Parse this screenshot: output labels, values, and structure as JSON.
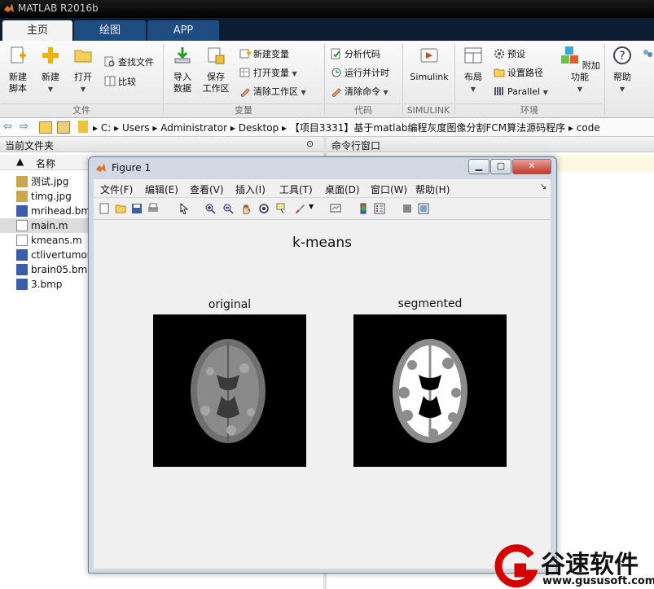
{
  "app": {
    "title": "MATLAB R2016b"
  },
  "tabs": [
    {
      "label": "主页"
    },
    {
      "label": "绘图"
    },
    {
      "label": "APP"
    }
  ],
  "ribbon": {
    "new_script": "新建\n脚本",
    "new": "新建",
    "open": "打开",
    "find_files": "查找文件",
    "compare": "比较",
    "import_data": "导入\n数据",
    "save_workspace": "保存\n工作区",
    "new_variable": "新建变量",
    "open_variable": "打开变量",
    "clear_workspace": "清除工作区",
    "analyze_code": "分析代码",
    "run_and_time": "运行并计时",
    "clear_commands": "清除命令",
    "simulink": "Simulink",
    "layout": "布局",
    "preferences": "预设",
    "set_path": "设置路径",
    "parallel": "Parallel",
    "addons": "附加功能",
    "help": "帮助",
    "groups": {
      "file": "文件",
      "variable": "变量",
      "code": "代码",
      "simulink": "SIMULINK",
      "environment": "环境"
    }
  },
  "address": {
    "segments": [
      "C:",
      "Users",
      "Administrator",
      "Desktop",
      "【项目3331】基于matlab编程灰度图像分割FCM算法源码程序",
      "code"
    ]
  },
  "left_panel": {
    "title": "当前文件夹",
    "col_name": "名称",
    "sort_arrow": "▲",
    "files": [
      {
        "name": "测试.jpg"
      },
      {
        "name": "timg.jpg"
      },
      {
        "name": "mrihead.bmp"
      },
      {
        "name": "main.m"
      },
      {
        "name": "kmeans.m"
      },
      {
        "name": "ctlivertumor"
      },
      {
        "name": "brain05.bmp"
      },
      {
        "name": "3.bmp"
      }
    ]
  },
  "command_window": {
    "title": "命令行窗口"
  },
  "figure": {
    "title": "Figure 1",
    "menu": [
      "文件(F)",
      "编辑(E)",
      "查看(V)",
      "插入(I)",
      "工具(T)",
      "桌面(D)",
      "窗口(W)",
      "帮助(H)"
    ],
    "suptitle": "k-means",
    "axes": [
      {
        "title": "original"
      },
      {
        "title": "segmented"
      }
    ]
  },
  "watermark": {
    "brand": "谷速软件",
    "url": "www.gususoft.com"
  },
  "colors": {
    "tab_active": "#f3f3f3",
    "tab_inactive": "#1e4b80",
    "tab_bar": "#0b1c33"
  }
}
